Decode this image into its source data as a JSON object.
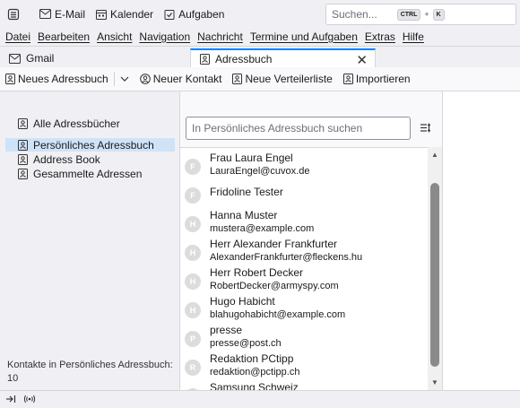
{
  "topbar": {
    "spaces": [
      {
        "label": "E-Mail",
        "icon": "envelope-icon"
      },
      {
        "label": "Kalender",
        "icon": "calendar-icon"
      },
      {
        "label": "Aufgaben",
        "icon": "tasks-icon"
      }
    ],
    "search_placeholder": "Suchen...",
    "shortcut_keys": [
      "CTRL",
      "+",
      "K"
    ]
  },
  "menubar": {
    "items": [
      "Datei",
      "Bearbeiten",
      "Ansicht",
      "Navigation",
      "Nachricht",
      "Termine und Aufgaben",
      "Extras",
      "Hilfe"
    ]
  },
  "tabs": [
    {
      "label": "Gmail",
      "icon": "mail-tab-icon"
    },
    {
      "label": "Adressbuch",
      "icon": "address-book-icon",
      "active": true
    }
  ],
  "abtoolbar": {
    "new_book": "Neues Adressbuch",
    "new_contact": "Neuer Kontakt",
    "new_list": "Neue Verteilerliste",
    "import": "Importieren"
  },
  "books": [
    {
      "label": "Alle Adressbücher",
      "selected": false
    },
    {
      "label": "Persönliches Adressbuch",
      "selected": true
    },
    {
      "label": "Address Book",
      "selected": false
    },
    {
      "label": "Gesammelte Adressen",
      "selected": false
    }
  ],
  "count": {
    "line1": "Kontakte in Persönliches Adressbuch:",
    "line2": "10"
  },
  "search": {
    "placeholder": "In Persönliches Adressbuch suchen"
  },
  "contacts": [
    {
      "initial": "F",
      "name": "Frau Laura Engel",
      "email": "LauraEngel@cuvox.de"
    },
    {
      "initial": "F",
      "name": "Fridoline Tester",
      "email": ""
    },
    {
      "initial": "H",
      "name": "Hanna Muster",
      "email": "mustera@example.com"
    },
    {
      "initial": "H",
      "name": "Herr Alexander Frankfurter",
      "email": "AlexanderFrankfurter@fleckens.hu"
    },
    {
      "initial": "H",
      "name": "Herr Robert Decker",
      "email": "RobertDecker@armyspy.com"
    },
    {
      "initial": "H",
      "name": "Hugo Habicht",
      "email": "blahugohabicht@example.com"
    },
    {
      "initial": "P",
      "name": "presse",
      "email": "presse@post.ch"
    },
    {
      "initial": "R",
      "name": "Redaktion PCtipp",
      "email": "redaktion@pctipp.ch"
    },
    {
      "initial": "S",
      "name": "Samsung Schweiz",
      "email": ""
    }
  ],
  "colors": {
    "accent": "#0a84ff",
    "selected_row": "#cfe3f8"
  }
}
